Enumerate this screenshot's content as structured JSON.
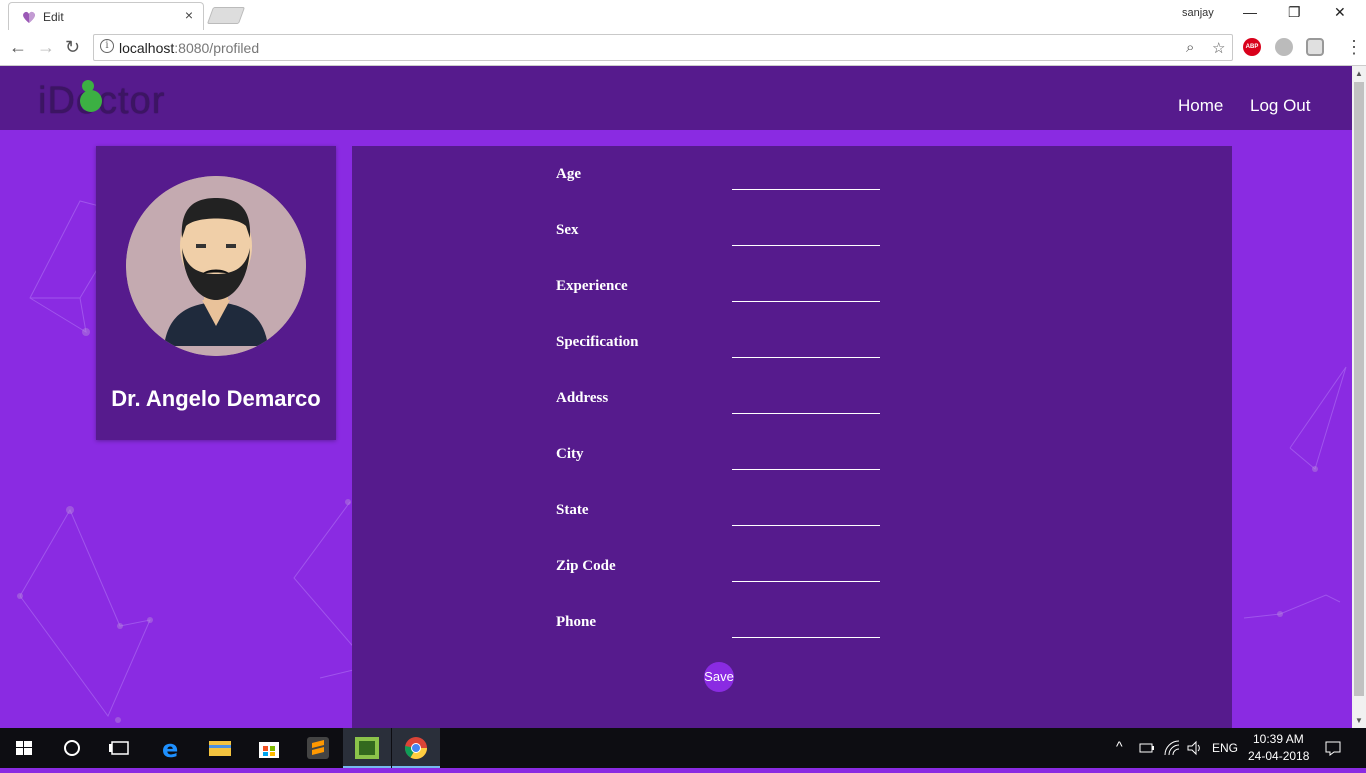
{
  "browser": {
    "tab_title": "Edit",
    "tab_close": "×",
    "profile": "sanjay",
    "url_host": "localhost",
    "url_rest": ":8080/profiled",
    "window_controls": {
      "minimize": "—",
      "restore": "❐",
      "close": "✕"
    },
    "nav": {
      "back": "←",
      "forward": "→",
      "reload": "↻"
    },
    "info_glyph": "i",
    "zoom_glyph": "⌕",
    "star_glyph": "☆",
    "menu_glyph": "⋮",
    "abp_label": "ABP"
  },
  "site": {
    "logo": "iDoctor",
    "nav": {
      "home": "Home",
      "logout": "Log Out"
    }
  },
  "profile": {
    "name": "Dr. Angelo Demarco"
  },
  "form": {
    "fields": [
      {
        "label": "Age",
        "value": ""
      },
      {
        "label": "Sex",
        "value": ""
      },
      {
        "label": "Experience",
        "value": ""
      },
      {
        "label": "Specification",
        "value": ""
      },
      {
        "label": "Address",
        "value": ""
      },
      {
        "label": "City",
        "value": ""
      },
      {
        "label": "State",
        "value": ""
      },
      {
        "label": "Zip Code",
        "value": ""
      },
      {
        "label": "Phone",
        "value": ""
      }
    ],
    "save_label": "Save"
  },
  "taskbar": {
    "lang": "ENG",
    "time": "10:39 AM",
    "date": "24-04-2018",
    "tray_up": "^"
  },
  "colors": {
    "page_bg": "#8a2be2",
    "panel_bg": "#561b8d",
    "logo_green": "#3cb043"
  }
}
